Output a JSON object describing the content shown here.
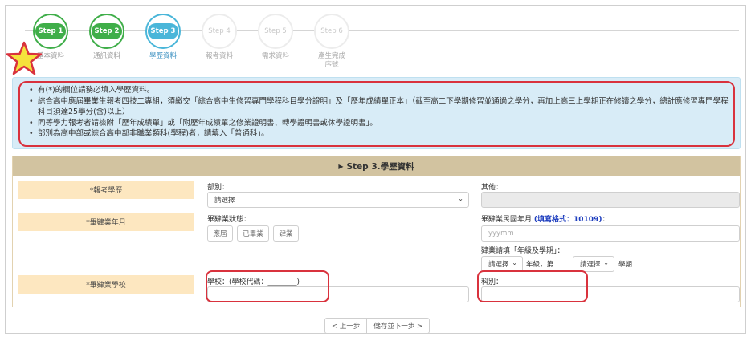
{
  "steps": [
    {
      "pill": "Step 1",
      "label": "基本資料",
      "state": "done"
    },
    {
      "pill": "Step 2",
      "label": "通訊資料",
      "state": "done"
    },
    {
      "pill": "Step 3",
      "label": "學歷資料",
      "state": "current"
    },
    {
      "pill": "Step 4",
      "label": "報考資料",
      "state": "todo"
    },
    {
      "pill": "Step 5",
      "label": "需求資料",
      "state": "todo"
    },
    {
      "pill": "Step 6",
      "label": "產生完成",
      "label2": "序號",
      "state": "todo"
    }
  ],
  "notice": {
    "items": [
      "有(*)的欄位請務必填入學歷資料。",
      "綜合高中應屆畢業生報考四技二專組，須繳交「綜合高中生修習專門學程科目學分證明」及「歷年成績單正本」（截至高二下學期修習並通過之學分，再加上高三上學期正在修讀之學分，總計應修習專門學程科目須達25學分(含)以上）",
      "同等學力報考者請檢附「歷年成績單」或「附歷年成績單之修業證明書、轉學證明書或休學證明書」。",
      "部別為高中部或綜合高中部非職業類科(學程)者，請填入「普通科」。"
    ]
  },
  "form": {
    "header": "Step 3.學歷資料",
    "exam_education": {
      "label": "*報考學歷",
      "dept_label": "部別：",
      "dept_value": "請選擇",
      "other_label": "其他："
    },
    "grad_year": {
      "label": "*畢肄業年月",
      "status_label": "畢肄業狀態：",
      "status_options": [
        "應屆",
        "已畢業",
        "肄業"
      ],
      "ym_label": "畢肄業民國年月",
      "ym_hint": "(填寫格式：10109)",
      "ym_colon": "：",
      "ym_placeholder": "yyymm",
      "dropout_label": "肄業請填「年級及學期」：",
      "grade_value": "請選擇",
      "grade_suffix": "年級，第",
      "term_value": "請選擇",
      "term_suffix": "學期"
    },
    "grad_school": {
      "label": "*畢肄業學校",
      "school_label": "學校：(學校代碼：________)",
      "subject_label": "科別："
    }
  },
  "nav": {
    "prev": "< 上一步",
    "next": "儲存並下一步 >"
  },
  "colors": {
    "done": "#3fae49",
    "current": "#4ab6d9",
    "highlight": "#d9323d"
  }
}
